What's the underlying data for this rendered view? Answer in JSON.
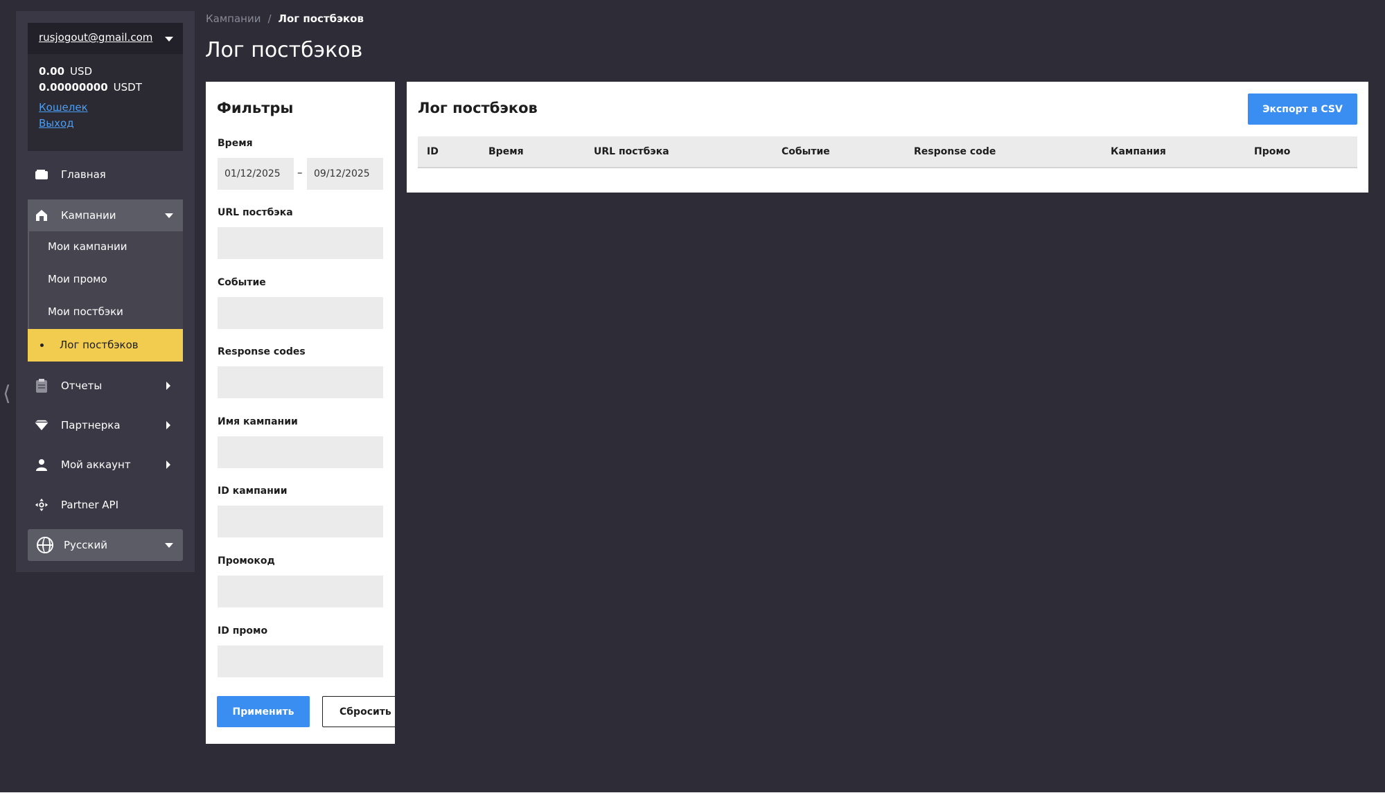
{
  "sidebar": {
    "account": {
      "email": "rusjogout@gmail.com",
      "balances": [
        {
          "amount": "0.00",
          "currency": "USD"
        },
        {
          "amount": "0.00000000",
          "currency": "USDT"
        }
      ],
      "wallet_link": "Кошелек",
      "logout_link": "Выход"
    },
    "nav": {
      "home": "Главная",
      "campaigns": "Кампании",
      "reports": "Отчеты",
      "partner": "Партнерка",
      "account": "Мой аккаунт",
      "api": "Partner API"
    },
    "submenu": [
      "Мои кампании",
      "Мои промо",
      "Мои постбэки",
      "Лог постбэков"
    ],
    "language": "Русский"
  },
  "breadcrumb": {
    "parent": "Кампании",
    "separator": "/",
    "current": "Лог постбэков"
  },
  "page": {
    "title": "Лог постбэков"
  },
  "filters": {
    "title": "Фильтры",
    "time_label": "Время",
    "date_from": "01/12/2025",
    "date_sep": "–",
    "date_to": "09/12/2025",
    "fields": [
      {
        "label": "URL постбэка",
        "value": ""
      },
      {
        "label": "Событие",
        "value": ""
      },
      {
        "label": "Response codes",
        "value": ""
      },
      {
        "label": "Имя кампании",
        "value": ""
      },
      {
        "label": "ID кампании",
        "value": ""
      },
      {
        "label": "Промокод",
        "value": ""
      },
      {
        "label": "ID промо",
        "value": ""
      }
    ],
    "apply_label": "Применить",
    "reset_label": "Сбросить"
  },
  "log": {
    "title": "Лог постбэков",
    "export_label": "Экспорт в CSV",
    "columns": [
      "ID",
      "Время",
      "URL постбэка",
      "Событие",
      "Response code",
      "Кампания",
      "Промо"
    ],
    "rows": []
  },
  "colors": {
    "background": "#2d2c37",
    "sidebar": "#393844",
    "accent_yellow": "#f2cc4e",
    "accent_blue": "#3a8ef2"
  }
}
